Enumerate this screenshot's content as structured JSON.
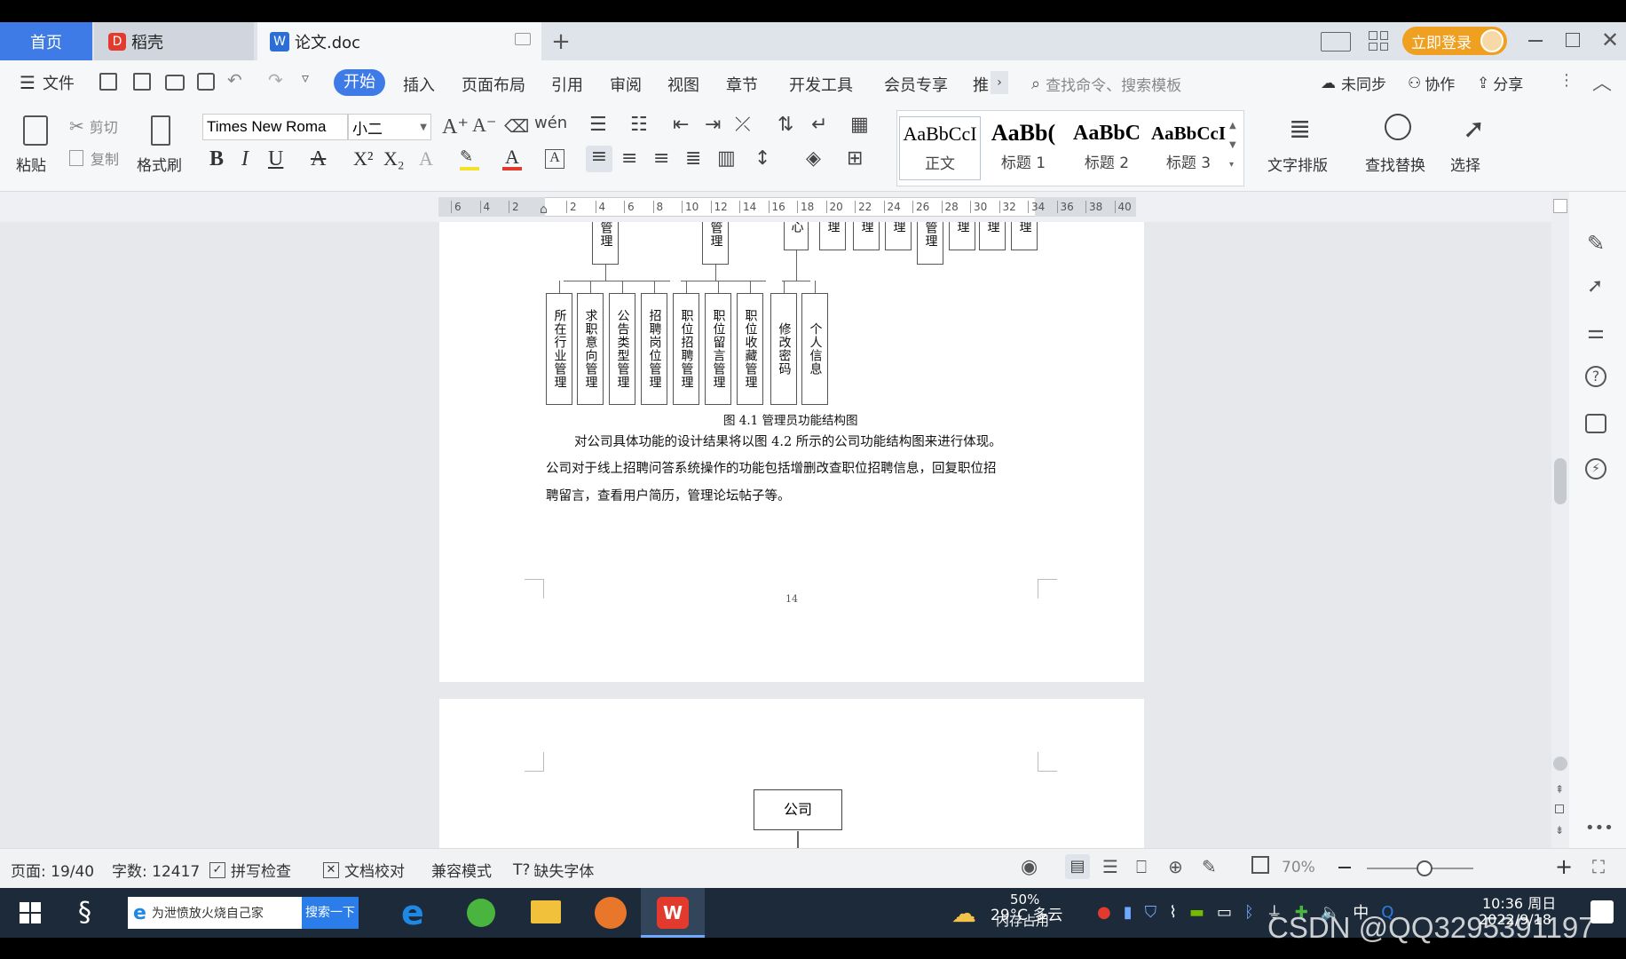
{
  "tabs": {
    "home": "首页",
    "daoke": "稻壳",
    "doc": "论文.doc",
    "login": "立即登录"
  },
  "menu": {
    "file": "文件",
    "start": "开始",
    "insert": "插入",
    "layout": "页面布局",
    "reference": "引用",
    "review": "审阅",
    "view": "视图",
    "chapter": "章节",
    "devtools": "开发工具",
    "member": "会员专享",
    "more": "推",
    "search_placeholder": "查找命令、搜索模板",
    "sync": "未同步",
    "collab": "协作",
    "share": "分享"
  },
  "ribbon": {
    "paste": "粘贴",
    "cut": "剪切",
    "copy": "复制",
    "format_painter": "格式刷",
    "font_name": "Times New Roma",
    "font_size": "小二",
    "styles": [
      {
        "preview": "AaBbCcI",
        "name": "正文"
      },
      {
        "preview": "AaBb(",
        "name": "标题 1"
      },
      {
        "preview": "AaBbC",
        "name": "标题 2"
      },
      {
        "preview": "AaBbCcI",
        "name": "标题 3"
      }
    ],
    "text_layout": "文字排版",
    "find_replace": "查找替换",
    "select": "选择"
  },
  "ruler": {
    "ticks": [
      "6",
      "4",
      "2",
      "",
      "2",
      "4",
      "6",
      "8",
      "10",
      "12",
      "14",
      "16",
      "18",
      "20",
      "22",
      "24",
      "26",
      "28",
      "30",
      "32",
      "34",
      "36",
      "38",
      "40"
    ]
  },
  "document": {
    "top_row_labels": [
      "管理",
      "管理",
      "心",
      "理",
      "理",
      "理",
      "管理",
      "理",
      "理",
      "理"
    ],
    "leaf_boxes": [
      "所在行业管理",
      "求职意向管理",
      "公告类型管理",
      "招聘岗位管理",
      "职位招聘管理",
      "职位留言管理",
      "职位收藏管理",
      "修改密码",
      "个人信息"
    ],
    "figure_caption": "图 4.1  管理员功能结构图",
    "paragraph_lines": [
      "对公司具体功能的设计结果将以图 4.2 所示的公司功能结构图来进行体现。",
      "公司对于线上招聘问答系统操作的功能包括增删改查职位招聘信息，回复职位招",
      "聘留言，查看用户简历，管理论坛帖子等。"
    ],
    "page_number": "14",
    "company_box": "公司"
  },
  "status": {
    "page": "页面: 19/40",
    "words": "字数: 12417",
    "spell": "拼写检查",
    "proof": "文档校对",
    "compat": "兼容模式",
    "missing_font": "缺失字体",
    "zoom": "70%"
  },
  "taskbar": {
    "news": "为泄愤放火烧自己家",
    "search_btn": "搜索一下",
    "weather": "29°C 多云",
    "memory": "50%",
    "memory_label": "内存占用",
    "ime": "中",
    "time": "10:36 周日",
    "date": "2022/9/18"
  },
  "watermark": "CSDN @QQ3295391197",
  "colors": {
    "accent": "#3e7be6",
    "login": "#f0a020",
    "taskbar": "#1c2a3a"
  }
}
